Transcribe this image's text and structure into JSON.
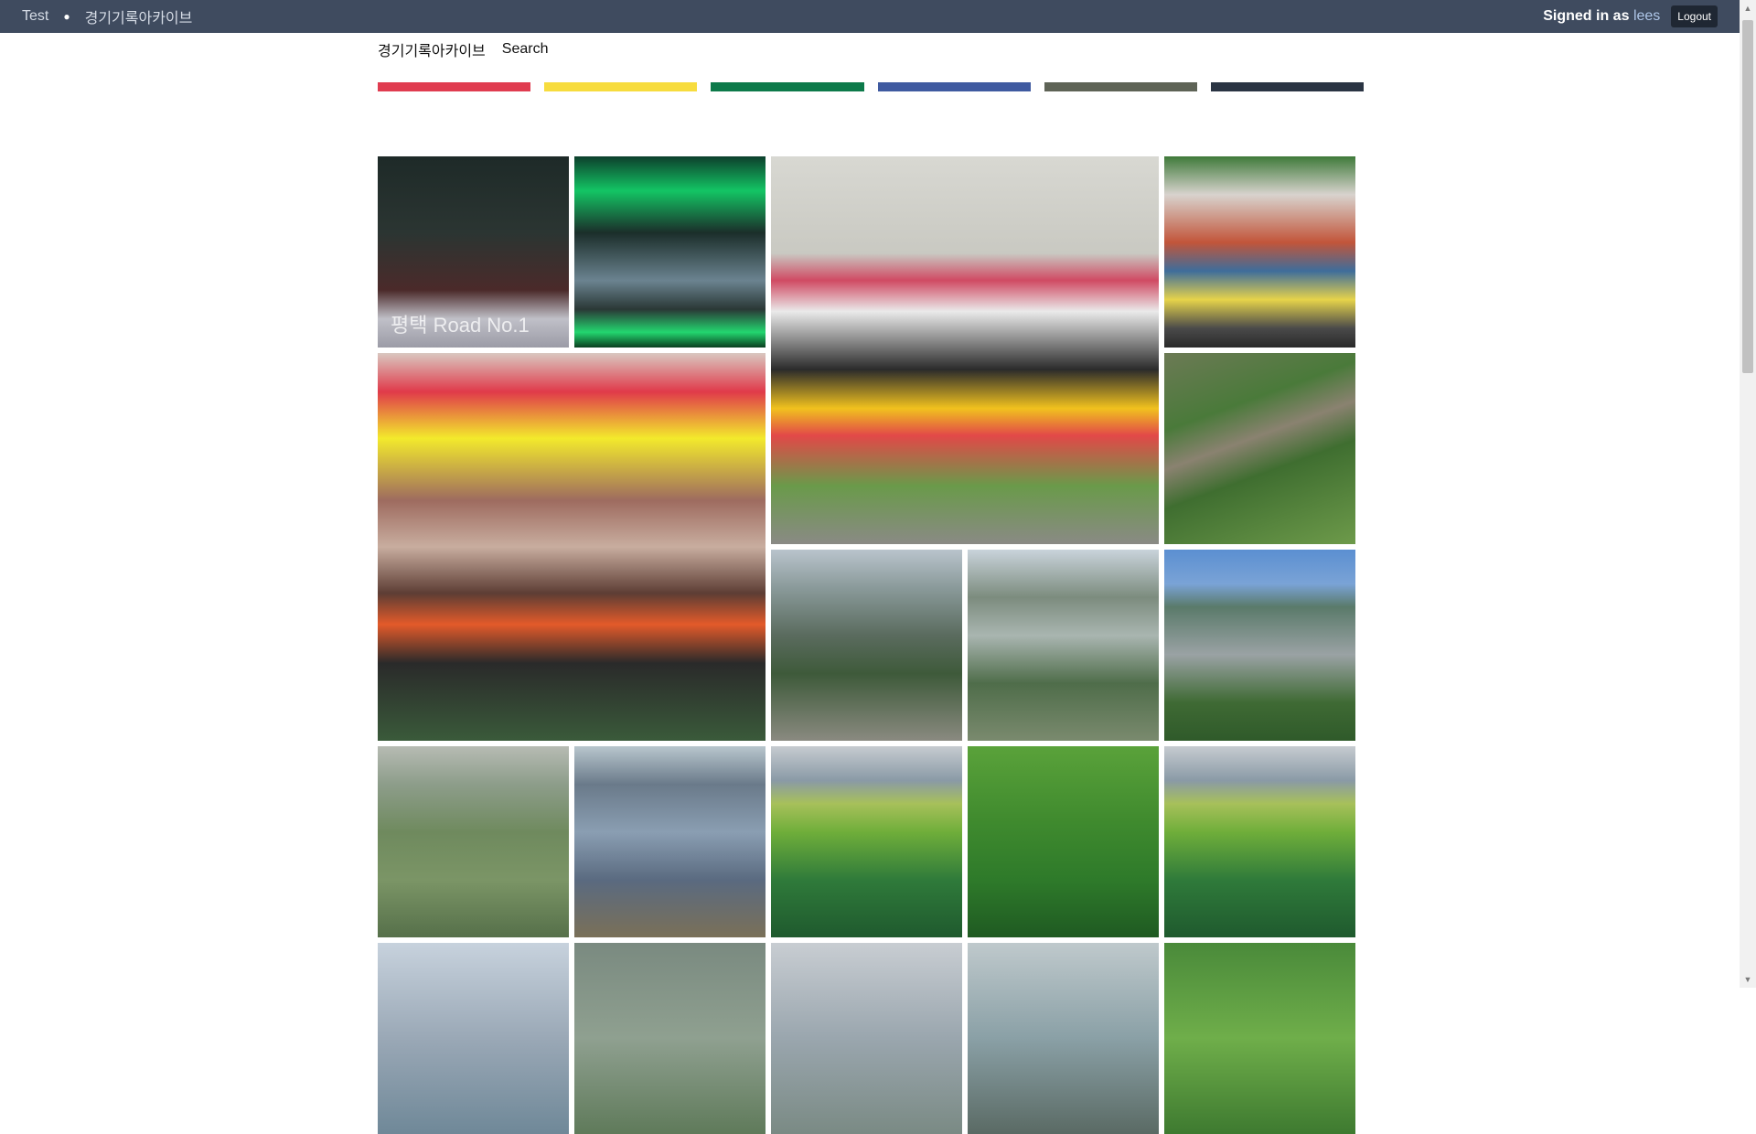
{
  "topbar": {
    "site_link": "Test",
    "archive_link": "경기기록아카이브",
    "signed_in_prefix": "Signed in as",
    "username": "lees",
    "logout_label": "Logout"
  },
  "subnav": {
    "home_link": "경기기록아카이브",
    "search_link": "Search"
  },
  "color_bars": [
    "#e03c50",
    "#f7dc3e",
    "#0d7a4a",
    "#3f5aa0",
    "#5e6356",
    "#2a3443"
  ],
  "gallery": {
    "tiles": [
      {
        "caption": "평택 Road No.1"
      }
    ]
  }
}
